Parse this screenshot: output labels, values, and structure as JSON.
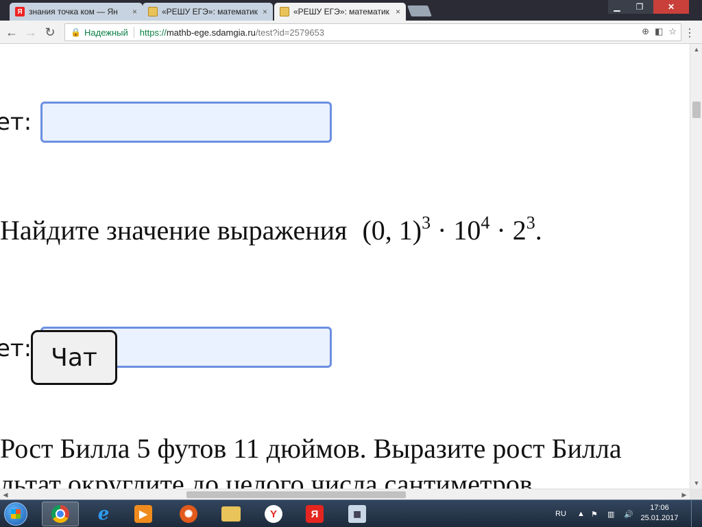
{
  "browser": {
    "tabs": [
      {
        "title": "знания точка ком — Ян",
        "favicon": "yandex-icon",
        "active": false
      },
      {
        "title": "«РЕШУ ЕГЭ»: математик",
        "favicon": "reshu-ege-icon",
        "active": false
      },
      {
        "title": "«РЕШУ ЕГЭ»: математик",
        "favicon": "reshu-ege-icon",
        "active": true
      }
    ],
    "close_glyph": "×",
    "security_label": "Надежный",
    "url_scheme": "https://",
    "url_host": "mathb-ege.sdamgia.ru",
    "url_path": "/test?id=2579653"
  },
  "page": {
    "answer_label": "ет:",
    "task_text": "Найдите значение выражения",
    "expression": {
      "base1": "(0, 1)",
      "exp1": "3",
      "dot": "·",
      "base2": "10",
      "exp2": "4",
      "base3": "2",
      "exp3": "3",
      "end": "."
    },
    "chat_label": "Чат",
    "next_task_line1": "Рост Билла 5 футов 11 дюймов. Выразите рост Билла",
    "next_task_line2": "льтат округлите до целого числа сантиметров."
  },
  "taskbar": {
    "language": "RU",
    "time": "17:06",
    "date": "25.01.2017"
  },
  "colors": {
    "input_bg": "#eaf1ff",
    "input_border": "#6b8fe0",
    "secure_green": "#0b8043"
  }
}
